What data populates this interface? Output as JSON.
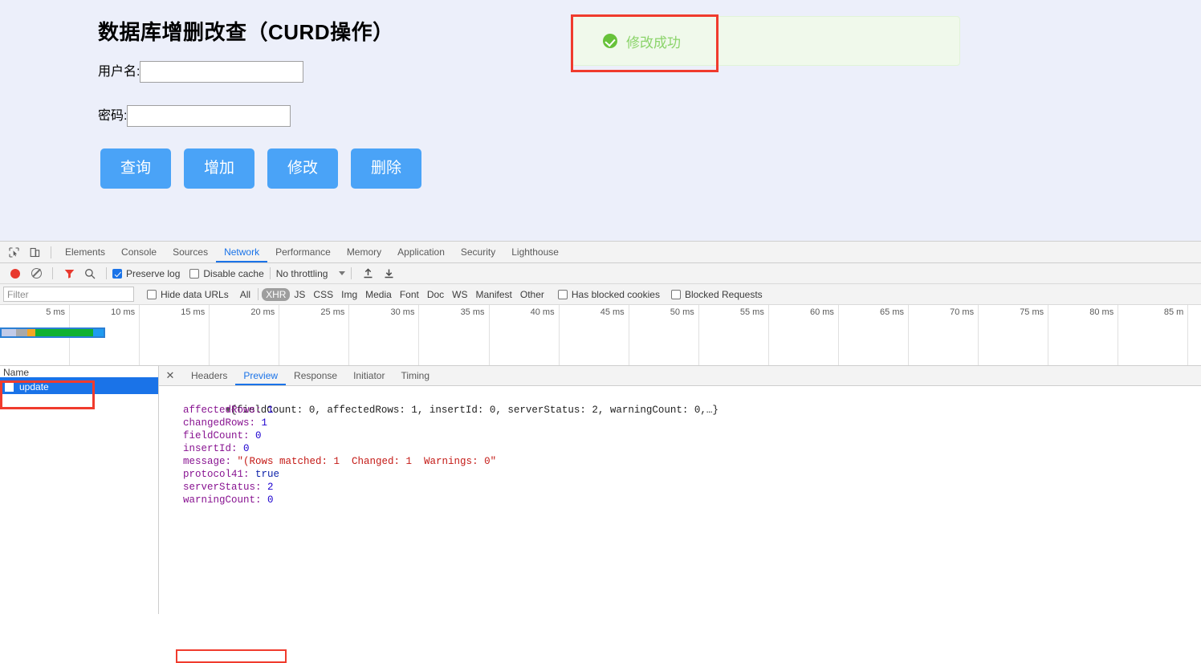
{
  "page": {
    "title": "数据库增删改查（CURD操作）",
    "background_color": "#eceffa",
    "fields": [
      {
        "label": "用户名:",
        "value": "",
        "placeholder": ""
      },
      {
        "label": "密码:",
        "value": "",
        "placeholder": ""
      }
    ],
    "buttons": [
      {
        "label": "查询"
      },
      {
        "label": "增加"
      },
      {
        "label": "修改"
      },
      {
        "label": "删除"
      }
    ],
    "button_color": "#4aa3f7",
    "alert": {
      "text": "修改成功",
      "icon": "check-circle-icon",
      "bg_color": "#f0f9eb",
      "text_color": "#8bd46a",
      "icon_color": "#67c23a"
    }
  },
  "annotations": {
    "color": "#f03b2d",
    "items": [
      "alert-highlight",
      "request-row-highlight",
      "affected-rows-highlight"
    ]
  },
  "devtools": {
    "tabs": [
      {
        "label": "Elements",
        "active": false
      },
      {
        "label": "Console",
        "active": false
      },
      {
        "label": "Sources",
        "active": false
      },
      {
        "label": "Network",
        "active": true
      },
      {
        "label": "Performance",
        "active": false
      },
      {
        "label": "Memory",
        "active": false
      },
      {
        "label": "Application",
        "active": false
      },
      {
        "label": "Security",
        "active": false
      },
      {
        "label": "Lighthouse",
        "active": false
      }
    ],
    "active_tab_color": "#1a73e8",
    "toolbar": {
      "record_title": "record-button",
      "clear_title": "clear-button",
      "filter_title": "filter-button",
      "search_title": "search-button",
      "preserve_log": {
        "label": "Preserve log",
        "checked": true
      },
      "disable_cache": {
        "label": "Disable cache",
        "checked": false
      },
      "throttling": {
        "value": "No throttling"
      },
      "import_title": "import-har-button",
      "export_title": "export-har-button"
    },
    "filter_row": {
      "filter_placeholder": "Filter",
      "filter_value": "",
      "hide_data_urls": {
        "label": "Hide data URLs",
        "checked": false
      },
      "types": [
        {
          "label": "All",
          "selected": false
        },
        {
          "label": "XHR",
          "selected": true
        },
        {
          "label": "JS",
          "selected": false
        },
        {
          "label": "CSS",
          "selected": false
        },
        {
          "label": "Img",
          "selected": false
        },
        {
          "label": "Media",
          "selected": false
        },
        {
          "label": "Font",
          "selected": false
        },
        {
          "label": "Doc",
          "selected": false
        },
        {
          "label": "WS",
          "selected": false
        },
        {
          "label": "Manifest",
          "selected": false
        },
        {
          "label": "Other",
          "selected": false
        }
      ],
      "has_blocked_cookies": {
        "label": "Has blocked cookies",
        "checked": false
      },
      "blocked_requests": {
        "label": "Blocked Requests",
        "checked": false
      }
    },
    "overview": {
      "ticks": [
        "5 ms",
        "10 ms",
        "15 ms",
        "20 ms",
        "25 ms",
        "30 ms",
        "35 ms",
        "40 ms",
        "45 ms",
        "50 ms",
        "55 ms",
        "60 ms",
        "65 ms",
        "70 ms",
        "75 ms",
        "80 ms",
        "85 m"
      ],
      "bar_segments": [
        {
          "color": "#c2cbe8",
          "width": 18
        },
        {
          "color": "#a9a9a9",
          "width": 14
        },
        {
          "color": "#f5a623",
          "width": 10
        },
        {
          "color": "#10b030",
          "width": 72
        },
        {
          "color": "#1f9bf0",
          "width": 13
        }
      ]
    },
    "requests": {
      "column_header": "Name",
      "rows": [
        {
          "name": "update",
          "selected": true,
          "icon": "document-icon"
        }
      ]
    },
    "detail": {
      "close_label": "✕",
      "tabs": [
        {
          "label": "Headers",
          "active": false
        },
        {
          "label": "Preview",
          "active": true
        },
        {
          "label": "Response",
          "active": false
        },
        {
          "label": "Initiator",
          "active": false
        },
        {
          "label": "Timing",
          "active": false
        }
      ],
      "preview": {
        "summary": "{fieldCount: 0, affectedRows: 1, insertId: 0, serverStatus: 2, warningCount: 0,…}",
        "entries": [
          {
            "key": "affectedRows",
            "value": "1",
            "type": "number"
          },
          {
            "key": "changedRows",
            "value": "1",
            "type": "number"
          },
          {
            "key": "fieldCount",
            "value": "0",
            "type": "number"
          },
          {
            "key": "insertId",
            "value": "0",
            "type": "number"
          },
          {
            "key": "message",
            "value": "\"(Rows matched: 1  Changed: 1  Warnings: 0\"",
            "type": "string"
          },
          {
            "key": "protocol41",
            "value": "true",
            "type": "boolean"
          },
          {
            "key": "serverStatus",
            "value": "2",
            "type": "number"
          },
          {
            "key": "warningCount",
            "value": "0",
            "type": "number"
          }
        ]
      }
    }
  }
}
